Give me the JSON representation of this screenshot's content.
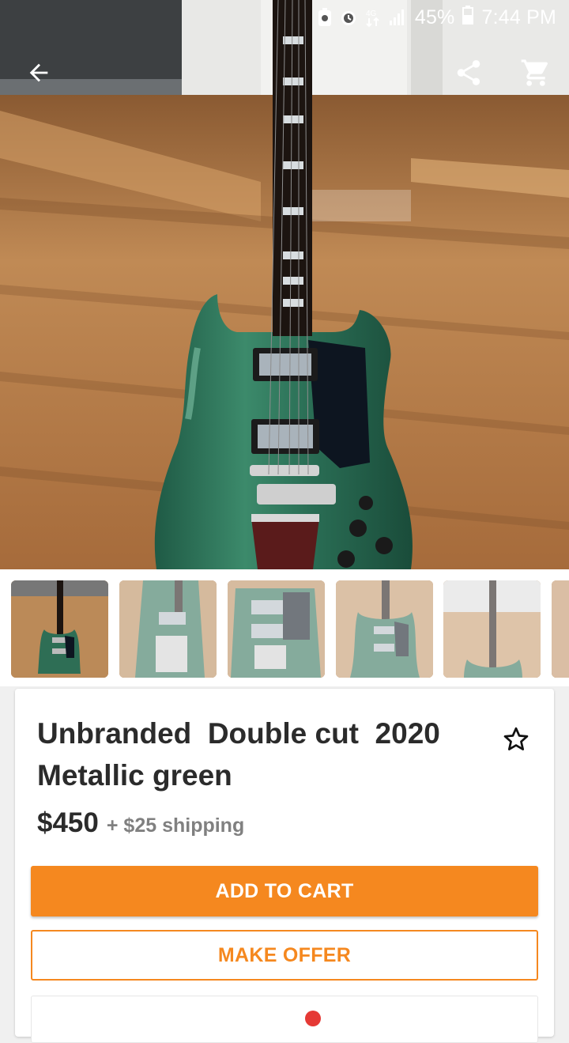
{
  "status_bar": {
    "battery_percent": "45%",
    "time": "7:44 PM",
    "network": "4G",
    "icons": [
      "battery-saver-icon",
      "alarm-icon",
      "data-4g-icon",
      "signal-icon",
      "battery-icon"
    ]
  },
  "action_bar": {
    "icons": [
      "back-arrow-icon",
      "share-icon",
      "cart-icon"
    ]
  },
  "gallery": {
    "thumbnail_count": 6,
    "selected_index": 0
  },
  "listing": {
    "title": "Unbranded  Double cut  2020\nMetallic green",
    "price": "$450",
    "shipping": "+ $25 shipping",
    "watch_icon": "star-outline-icon"
  },
  "actions": {
    "add_to_cart": "ADD TO CART",
    "make_offer": "MAKE OFFER"
  },
  "colors": {
    "accent": "#f5881f",
    "title_text": "#2b2b2b",
    "muted_text": "#808080",
    "guitar_body": "#2e6e55"
  }
}
